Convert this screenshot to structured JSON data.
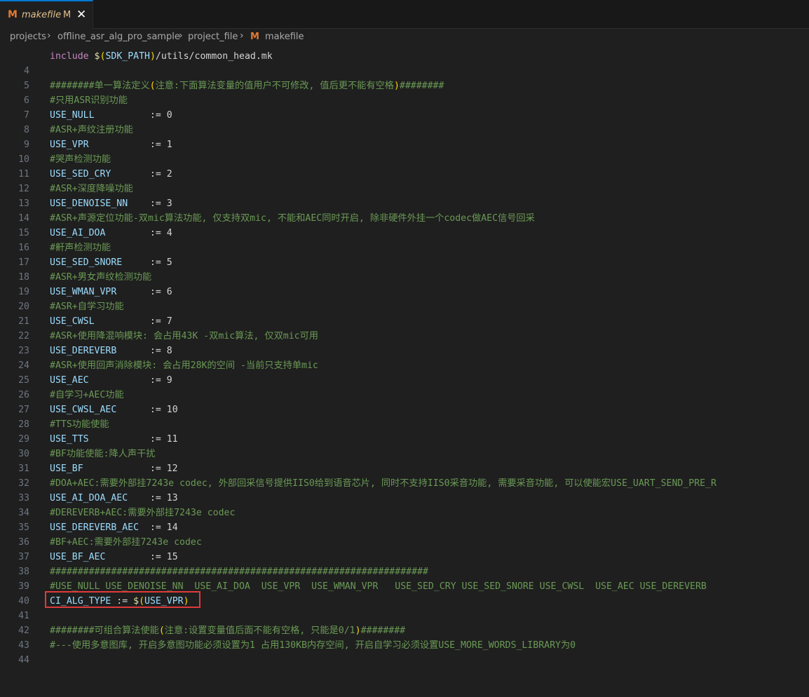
{
  "tab": {
    "label": "makefile",
    "modified_marker": "M",
    "icon": "M"
  },
  "breadcrumb": {
    "items": [
      "projects",
      "offline_asr_alg_pro_sample",
      "project_file",
      "makefile"
    ],
    "separator": "›"
  },
  "colors": {
    "keyword": "#c586c0",
    "variable": "#9cdcfe",
    "comment": "#6a9955",
    "highlight_box": "#e03a3a",
    "file_icon": "#e37933"
  },
  "lines": {
    "l4": {
      "n": "4",
      "kw": "include",
      "a": "$",
      "b": "(",
      "c": "SDK_PATH",
      "d": ")",
      "e": "/utils/common_head.mk"
    },
    "l5": {
      "n": "5"
    },
    "l6": {
      "n": "6",
      "a": "########单一算法定义",
      "b": "(",
      "c": "注意:下面算法变量的值用户不可修改, 值后更不能有空格",
      "d": ")",
      "e": "########"
    },
    "l7": {
      "n": "7",
      "c": "#只用ASR识别功能"
    },
    "l8": {
      "n": "8",
      "v": "USE_NULL",
      "o": "          := ",
      "val": "0"
    },
    "l9": {
      "n": "9",
      "c": "#ASR+声纹注册功能"
    },
    "l10": {
      "n": "10",
      "v": "USE_VPR",
      "o": "           := ",
      "val": "1"
    },
    "l11": {
      "n": "11",
      "c": "#哭声检测功能"
    },
    "l12": {
      "n": "12",
      "v": "USE_SED_CRY",
      "o": "       := ",
      "val": "2"
    },
    "l13": {
      "n": "13",
      "c": "#ASR+深度降噪功能"
    },
    "l14": {
      "n": "14",
      "v": "USE_DENOISE_NN",
      "o": "    := ",
      "val": "3"
    },
    "l15": {
      "n": "15",
      "c": "#ASR+声源定位功能-双mic算法功能, 仅支持双mic, 不能和AEC同时开启, 除非硬件外挂一个codec做AEC信号回采"
    },
    "l16": {
      "n": "16",
      "v": "USE_AI_DOA",
      "o": "        := ",
      "val": "4"
    },
    "l17": {
      "n": "17",
      "c": "#鼾声检测功能"
    },
    "l18": {
      "n": "18",
      "v": "USE_SED_SNORE",
      "o": "     := ",
      "val": "5"
    },
    "l19": {
      "n": "19",
      "c": "#ASR+男女声纹检测功能"
    },
    "l20": {
      "n": "20",
      "v": "USE_WMAN_VPR",
      "o": "      := ",
      "val": "6"
    },
    "l21": {
      "n": "21",
      "c": "#ASR+自学习功能"
    },
    "l22": {
      "n": "22",
      "v": "USE_CWSL",
      "o": "          := ",
      "val": "7"
    },
    "l23": {
      "n": "23",
      "c": "#ASR+使用降混响模块: 会占用43K -双mic算法, 仅双mic可用"
    },
    "l24": {
      "n": "24",
      "v": "USE_DEREVERB",
      "o": "      := ",
      "val": "8"
    },
    "l25": {
      "n": "25",
      "c": "#ASR+使用回声消除模块: 会占用28K的空间 -当前只支持单mic"
    },
    "l26": {
      "n": "26",
      "v": "USE_AEC",
      "o": "           := ",
      "val": "9"
    },
    "l27": {
      "n": "27",
      "c": "#自学习+AEC功能"
    },
    "l28": {
      "n": "28",
      "v": "USE_CWSL_AEC",
      "o": "      := ",
      "val": "10"
    },
    "l29": {
      "n": "29",
      "c": "#TTS功能使能"
    },
    "l30": {
      "n": "30",
      "v": "USE_TTS",
      "o": "           := ",
      "val": "11"
    },
    "l31": {
      "n": "31",
      "c": "#BF功能使能:降人声干扰"
    },
    "l32": {
      "n": "32",
      "v": "USE_BF",
      "o": "            := ",
      "val": "12"
    },
    "l33": {
      "n": "33",
      "c": "#DOA+AEC:需要外部挂7243e codec, 外部回采信号提供IIS0给到语音芯片, 同时不支持IIS0采音功能, 需要采音功能, 可以使能宏USE_UART_SEND_PRE_R"
    },
    "l34": {
      "n": "34",
      "v": "USE_AI_DOA_AEC",
      "o": "    := ",
      "val": "13"
    },
    "l35": {
      "n": "35",
      "c": "#DEREVERB+AEC:需要外部挂7243e codec"
    },
    "l36": {
      "n": "36",
      "v": "USE_DEREVERB_AEC",
      "o": "  := ",
      "val": "14"
    },
    "l37": {
      "n": "37",
      "c": "#BF+AEC:需要外部挂7243e codec"
    },
    "l38": {
      "n": "38",
      "v": "USE_BF_AEC",
      "o": "        := ",
      "val": "15"
    },
    "l39": {
      "n": "39",
      "c": "####################################################################"
    },
    "l40": {
      "n": "40",
      "c": "#USE_NULL USE_DENOISE_NN  USE_AI_DOA  USE_VPR  USE_WMAN_VPR   USE_SED_CRY USE_SED_SNORE USE_CWSL  USE_AEC USE_DEREVERB"
    },
    "l41": {
      "n": "41",
      "v": "CI_ALG_TYPE",
      "o": " := ",
      "a": "$",
      "b": "(",
      "c": "USE_VPR",
      "d": ")"
    },
    "l42": {
      "n": "42"
    },
    "l43": {
      "n": "43",
      "a": "########可组合算法使能",
      "b": "(",
      "c": "注意:设置变量值后面不能有空格, 只能是0/1",
      "d": ")",
      "e": "########"
    },
    "l44": {
      "n": "44",
      "c": "#---使用多意图库, 开启多意图功能必须设置为1 占用130KB内存空间, 开启自学习必须设置USE_MORE_WORDS_LIBRARY为0"
    }
  }
}
